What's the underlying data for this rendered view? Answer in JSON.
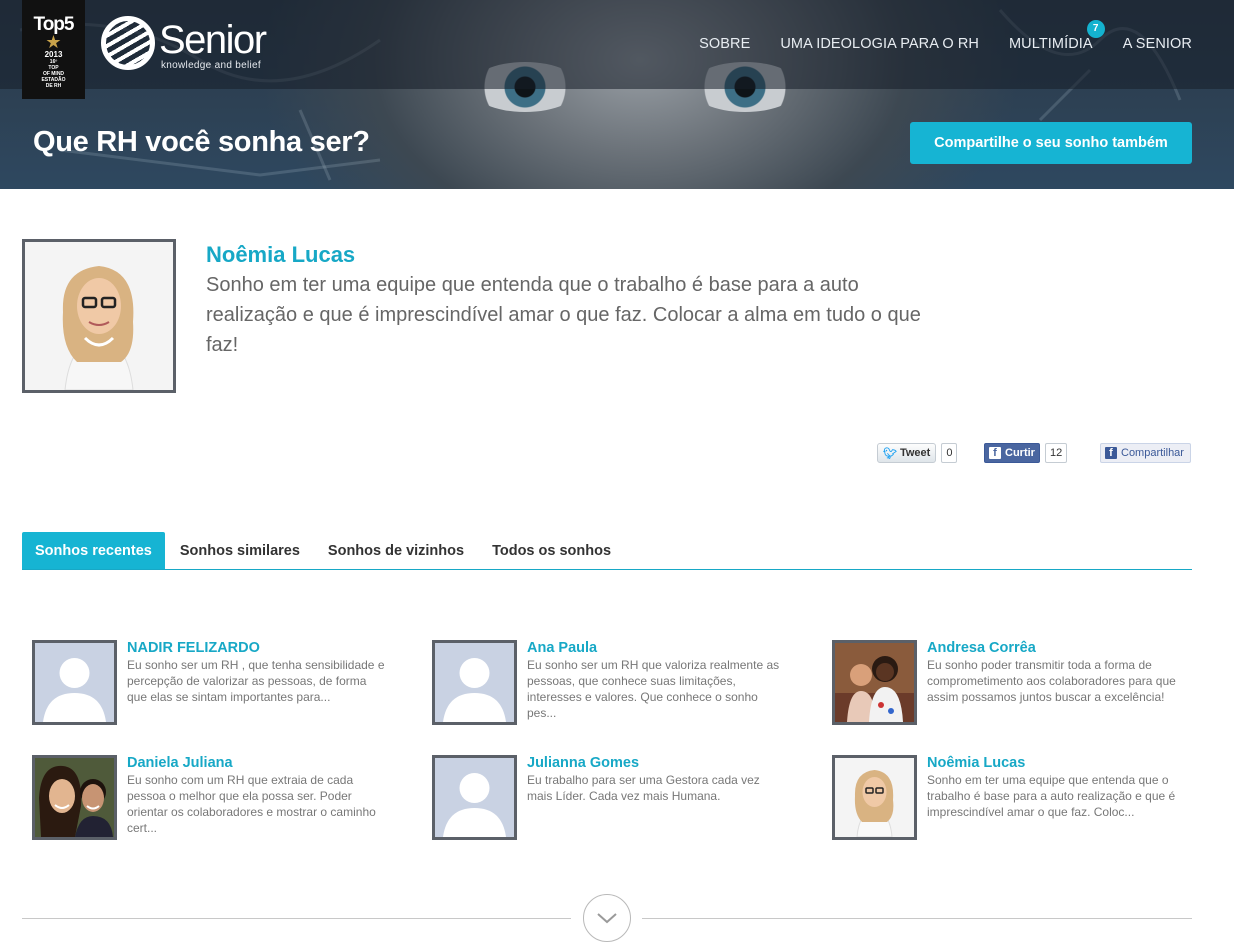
{
  "award": {
    "big": "Top5",
    "year": "2013",
    "line1": "16º",
    "line2": "TOP",
    "line3": "OF MIND",
    "line4": "ESTADÃO",
    "line5": "DE RH"
  },
  "brand": {
    "name": "Senior",
    "tagline": "knowledge and belief"
  },
  "nav": {
    "items": [
      {
        "label": "SOBRE"
      },
      {
        "label": "UMA IDEOLOGIA PARA O RH"
      },
      {
        "label": "MULTIMÍDIA",
        "badge": "7"
      },
      {
        "label": "A SENIOR"
      }
    ]
  },
  "hero": {
    "title": "Que RH você sonha ser?",
    "cta_label": "Compartilhe o seu sonho também"
  },
  "featured": {
    "name": "Noêmia Lucas",
    "text": "Sonho em ter uma equipe que entenda que o trabalho é base para a auto realização e que é imprescindível amar o que faz. Colocar a alma em tudo o que faz!"
  },
  "social": {
    "tweet_label": "Tweet",
    "tweet_count": "0",
    "like_label": "Curtir",
    "like_count": "12",
    "share_label": "Compartilhar"
  },
  "tabs": [
    {
      "label": "Sonhos recentes",
      "active": true
    },
    {
      "label": "Sonhos similares",
      "active": false
    },
    {
      "label": "Sonhos de vizinhos",
      "active": false
    },
    {
      "label": "Todos os sonhos",
      "active": false
    }
  ],
  "dreams": [
    {
      "name": "NADIR FELIZARDO",
      "text": "Eu sonho ser um RH , que tenha sensibilidade e percepção de valorizar as pessoas, de forma que elas se sintam importantes para...",
      "avatar": "placeholder"
    },
    {
      "name": "Ana Paula",
      "text": "Eu sonho ser um RH que valoriza realmente as pessoas, que conhece suas limitações, interesses e valores. Que conhece o sonho pes...",
      "avatar": "placeholder"
    },
    {
      "name": "Andresa Corrêa",
      "text": "Eu sonho poder transmitir toda a forma de comprometimento aos colaboradores para que assim possamos juntos buscar a excelência!",
      "avatar": "photo-group"
    },
    {
      "name": "Daniela Juliana",
      "text": "Eu sonho com um RH que extraia de cada pessoa o melhor que ela possa ser. Poder orientar os colaboradores e mostrar o caminho cert...",
      "avatar": "photo-couple"
    },
    {
      "name": "Julianna Gomes",
      "text": "Eu trabalho para ser uma Gestora cada vez mais Líder. Cada vez mais Humana.",
      "avatar": "placeholder"
    },
    {
      "name": "Noêmia Lucas",
      "text": "Sonho em ter uma equipe que entenda que o trabalho é base para a auto realização e que é imprescindível amar o que faz. Coloc...",
      "avatar": "photo-woman"
    }
  ],
  "colors": {
    "accent": "#16b4d3",
    "name_color": "#17a8c6",
    "facebook": "#4a66a0"
  },
  "icons": {
    "more": "chevron-down-icon",
    "tweet": "twitter-bird-icon",
    "facebook": "facebook-f-icon"
  }
}
